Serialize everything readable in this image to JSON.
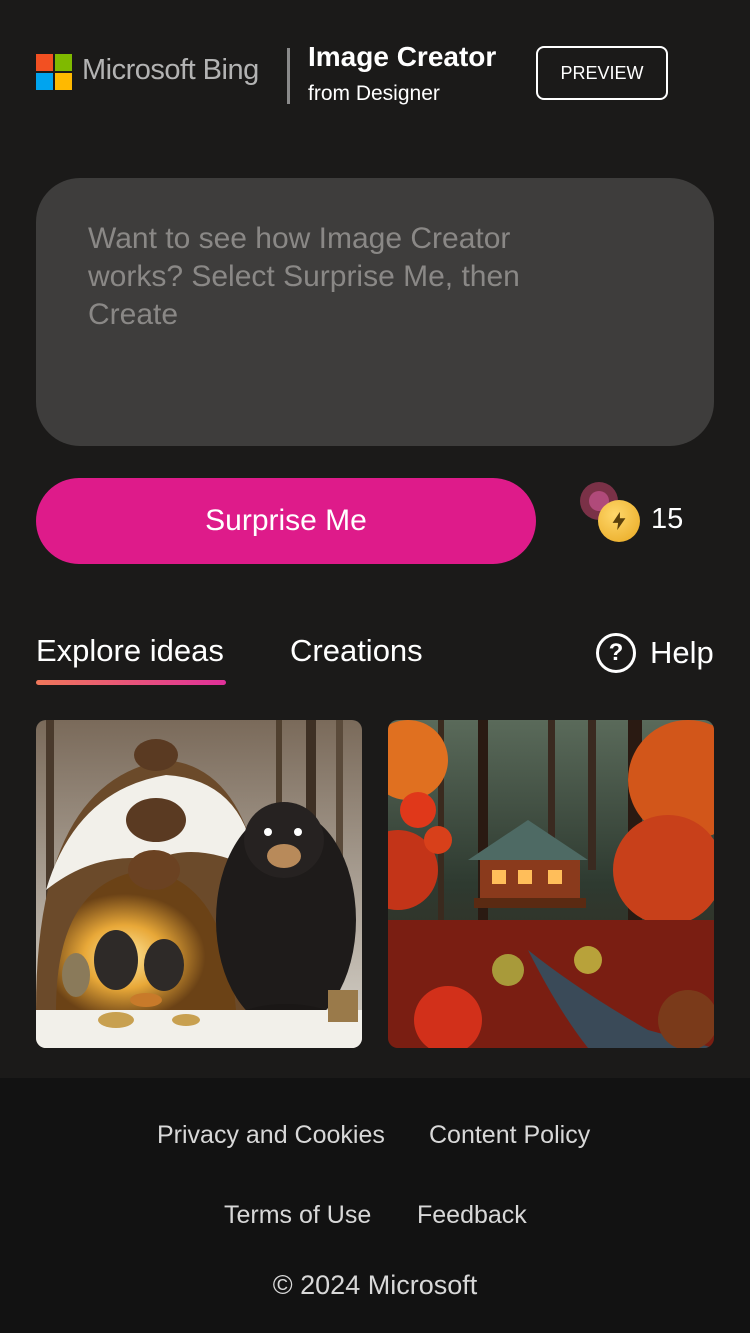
{
  "header": {
    "brand": "Microsoft Bing",
    "title": "Image Creator",
    "subtitle": "from Designer",
    "preview_label": "PREVIEW",
    "logo_colors": [
      "#f25022",
      "#7fba00",
      "#00a4ef",
      "#ffb900"
    ]
  },
  "prompt": {
    "placeholder": "Want to see how Image Creator works? Select Surprise Me, then Create"
  },
  "actions": {
    "surprise_label": "Surprise Me",
    "boost_icon": "lightning-coin-icon",
    "boost_count": "15"
  },
  "tabs": {
    "explore_label": "Explore ideas",
    "creations_label": "Creations",
    "help_label": "Help",
    "help_icon": "question-circle-icon"
  },
  "gallery": {
    "items": [
      {
        "name": "bears-in-tree-den-image"
      },
      {
        "name": "autumn-cabin-forest-image"
      }
    ]
  },
  "footer": {
    "privacy": "Privacy and Cookies",
    "content_policy": "Content Policy",
    "terms": "Terms of Use",
    "feedback": "Feedback",
    "copyright": "© 2024 Microsoft"
  },
  "colors": {
    "accent": "#de1b8a",
    "background": "#1b1a19",
    "prompt_bg": "#3e3d3c"
  }
}
